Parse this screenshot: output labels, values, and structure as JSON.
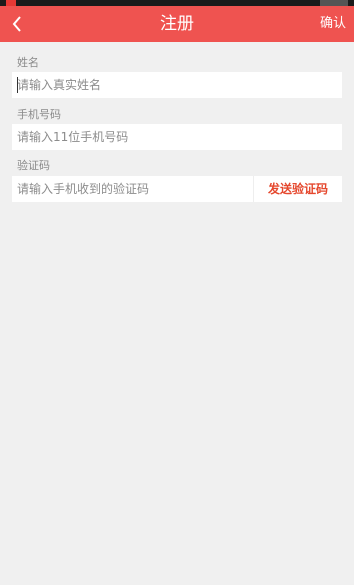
{
  "app_bar": {
    "title": "注册",
    "confirm_label": "确认",
    "accent_color": "#ef5350"
  },
  "form": {
    "name": {
      "label": "姓名",
      "placeholder": "请输入真实姓名"
    },
    "phone": {
      "label": "手机号码",
      "placeholder": "请输入11位手机号码"
    },
    "code": {
      "label": "验证码",
      "placeholder": "请输入手机收到的验证码",
      "send_label": "发送验证码",
      "send_color": "#e5482e"
    }
  },
  "icons": {
    "back": "chevron-left-icon"
  }
}
